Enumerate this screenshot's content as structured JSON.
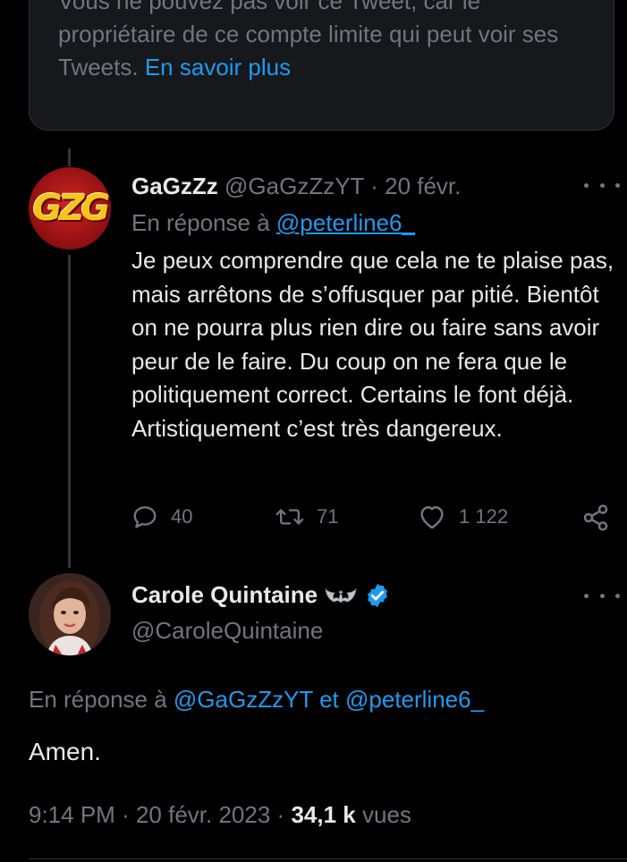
{
  "notice": {
    "text": "Vous ne pouvez pas voir ce Tweet, car le propriétaire de ce compte limite qui peut voir ses Tweets.",
    "link": "En savoir plus"
  },
  "tweet1": {
    "avatar_text": "GZG",
    "name": "GaGzZz",
    "handle": "@GaGzZzYT",
    "separator": "·",
    "date": "20 févr.",
    "reply_prefix": "En réponse à",
    "reply_handle": "@peterline6_",
    "body": "Je peux comprendre que cela ne te plaise pas, mais arrêtons de s’offusquer par pitié. Bientôt on ne pourra plus rien dire ou faire sans avoir peur de le faire. Du coup on ne fera que le politiquement correct. Certains le font déjà. Artistiquement c’est très dangereux.",
    "replies": "40",
    "retweets": "71",
    "likes": "1 122"
  },
  "tweet2": {
    "name": "Carole Quintaine",
    "handle": "@CaroleQuintaine",
    "reply_prefix": "En réponse à",
    "reply_handle_1": "@GaGzZzYT",
    "reply_and": "et",
    "reply_handle_2": "@peterline6_",
    "body": "Amen.",
    "time": "9:14 PM",
    "separator": "·",
    "date": "20 févr. 2023",
    "separator2": "·",
    "views_count": "34,1 k",
    "views_label": "vues"
  },
  "colors": {
    "accent": "#1d9bf0",
    "muted": "#71767b",
    "text": "#e7e9ea",
    "background": "#000000"
  },
  "icons": [
    "more-icon",
    "reply-icon",
    "retweet-icon",
    "like-icon",
    "share-icon",
    "bat-icon",
    "verified-badge-icon"
  ]
}
